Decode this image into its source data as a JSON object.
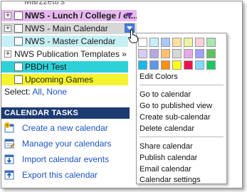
{
  "calendars": [
    {
      "label": "NWS - Lunch / College / et...",
      "bg": "#e6b8ee",
      "expander": "+",
      "bold": true
    },
    {
      "label": "NWS - Main Calendar",
      "bg": "#d7d7d7",
      "expander": "+",
      "bold": false
    },
    {
      "label": "NWS - Master Calendar",
      "bg": "#c6f0f6",
      "expander": "",
      "bold": false
    },
    {
      "label": "NWS Publication Templates »",
      "bg": "#ffffff",
      "expander": "+",
      "bold": false
    },
    {
      "label": "PBDH Test",
      "bg": "#2fd1d8",
      "expander": "",
      "bold": false
    },
    {
      "label": "Upcoming Games",
      "bg": "#f5f32e",
      "expander": "",
      "bold": false
    }
  ],
  "top_cut_label": "Marzzetti's",
  "select": {
    "prefix": "Select:",
    "all": "All",
    "comma": ",",
    "none": "None"
  },
  "tasks": {
    "header": "CALENDAR TASKS",
    "items": [
      {
        "label": "Create a new calendar",
        "icon": "calendar-plus-icon"
      },
      {
        "label": "Manage your calendars",
        "icon": "calendar-manage-icon"
      },
      {
        "label": "Import calendar events",
        "icon": "calendar-import-icon"
      },
      {
        "label": "Export this calendar",
        "icon": "calendar-export-icon"
      }
    ]
  },
  "menu": {
    "swatches": [
      "#ffffff",
      "#c8efff",
      "#a8c8ff",
      "#ffe0a0",
      "#eef3a0",
      "#ffd0d8",
      "#a8e8b0",
      "#d7cdf3",
      "#b8a8e0",
      "#ffc070",
      "#d8d8d8",
      "#e8a8e8",
      "#a0a0ff",
      "#60c060",
      "#18b8e8",
      "#6098e8",
      "#ff9010",
      "#ffff10",
      "#f01050",
      "#80d8ff",
      "#18c860"
    ],
    "edit_colors": "Edit Colors",
    "group1": [
      "Go to calendar",
      "Go to published view",
      "Create sub-calendar",
      "Delete calendar"
    ],
    "group2": [
      "Share calendar",
      "Publish calendar",
      "Email calendar",
      "Calendar settings"
    ]
  },
  "colors": {
    "link": "#1c55c2",
    "tasks_header_bg": "#1d3b73",
    "dropdown_arrow_bg": "#4b7bd6"
  }
}
